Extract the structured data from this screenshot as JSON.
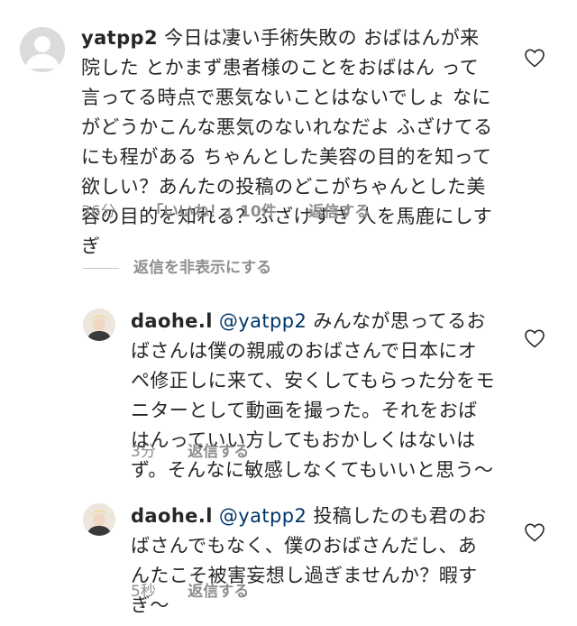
{
  "comments": [
    {
      "username": "yatpp2",
      "mention": "",
      "text": "今日は凄い手術失敗の おばはんが来院した とかまず患者様のことをおばはん って言ってる時点で悪気ないことはないでしょ なにがどうかこんな悪気のないれなだよ ふざけてるにも程がある ちゃんとした美容の目的を知って欲しい？あんたの投稿のどこがちゃんとした美容の目的を知れる？ふざけすぎ 人を馬鹿にしすぎ",
      "time": "36分",
      "likes": "「いいね！」10件",
      "reply": "返信する"
    },
    {
      "username": "daohe.l",
      "mention": "@yatpp2",
      "text": "みんなが思ってるおばさんは僕の親戚のおばさんで日本にオペ修正しに来て、安くしてもらった分をモニターとして動画を撮った。それをおばはんっていい方してもおかしくはないはず。そんなに敏感しなくてもいいと思う〜",
      "time": "3分",
      "reply": "返信する"
    },
    {
      "username": "daohe.l",
      "mention": "@yatpp2",
      "text": "投稿したのも君のおばさんでもなく、僕のおばさんだし、あんたこそ被害妄想し過ぎませんか？暇すぎ〜",
      "time": "5秒",
      "reply": "返信する"
    }
  ],
  "hide_replies": "返信を非表示にする",
  "icons": {
    "like": "heart-outline-icon",
    "avatar_default": "default-avatar-icon"
  },
  "colors": {
    "text": "#262626",
    "muted": "#8e8e8e",
    "mention": "#003569"
  }
}
